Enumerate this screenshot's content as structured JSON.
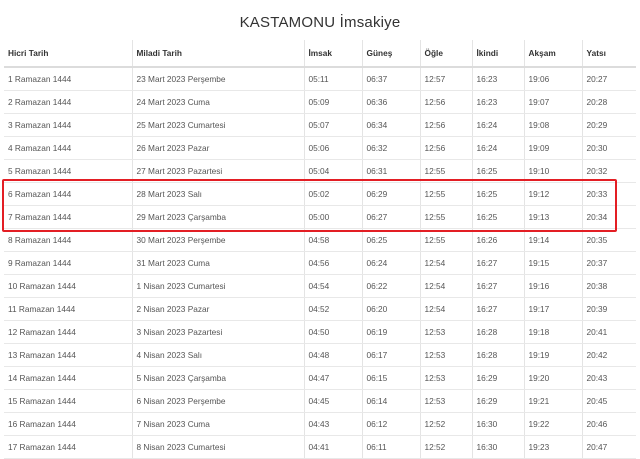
{
  "page": {
    "title": "KASTAMONU İmsakiye"
  },
  "table": {
    "columns": [
      "Hicri Tarih",
      "Miladi Tarih",
      "İmsak",
      "Güneş",
      "Öğle",
      "İkindi",
      "Akşam",
      "Yatsı"
    ],
    "rows": [
      [
        "1 Ramazan 1444",
        "23 Mart 2023 Perşembe",
        "05:11",
        "06:37",
        "12:57",
        "16:23",
        "19:06",
        "20:27"
      ],
      [
        "2 Ramazan 1444",
        "24 Mart 2023 Cuma",
        "05:09",
        "06:36",
        "12:56",
        "16:23",
        "19:07",
        "20:28"
      ],
      [
        "3 Ramazan 1444",
        "25 Mart 2023 Cumartesi",
        "05:07",
        "06:34",
        "12:56",
        "16:24",
        "19:08",
        "20:29"
      ],
      [
        "4 Ramazan 1444",
        "26 Mart 2023 Pazar",
        "05:06",
        "06:32",
        "12:56",
        "16:24",
        "19:09",
        "20:30"
      ],
      [
        "5 Ramazan 1444",
        "27 Mart 2023 Pazartesi",
        "05:04",
        "06:31",
        "12:55",
        "16:25",
        "19:10",
        "20:32"
      ],
      [
        "6 Ramazan 1444",
        "28 Mart 2023 Salı",
        "05:02",
        "06:29",
        "12:55",
        "16:25",
        "19:12",
        "20:33"
      ],
      [
        "7 Ramazan 1444",
        "29 Mart 2023 Çarşamba",
        "05:00",
        "06:27",
        "12:55",
        "16:25",
        "19:13",
        "20:34"
      ],
      [
        "8 Ramazan 1444",
        "30 Mart 2023 Perşembe",
        "04:58",
        "06:25",
        "12:55",
        "16:26",
        "19:14",
        "20:35"
      ],
      [
        "9 Ramazan 1444",
        "31 Mart 2023 Cuma",
        "04:56",
        "06:24",
        "12:54",
        "16:27",
        "19:15",
        "20:37"
      ],
      [
        "10 Ramazan 1444",
        "1 Nisan 2023 Cumartesi",
        "04:54",
        "06:22",
        "12:54",
        "16:27",
        "19:16",
        "20:38"
      ],
      [
        "11 Ramazan 1444",
        "2 Nisan 2023 Pazar",
        "04:52",
        "06:20",
        "12:54",
        "16:27",
        "19:17",
        "20:39"
      ],
      [
        "12 Ramazan 1444",
        "3 Nisan 2023 Pazartesi",
        "04:50",
        "06:19",
        "12:53",
        "16:28",
        "19:18",
        "20:41"
      ],
      [
        "13 Ramazan 1444",
        "4 Nisan 2023 Salı",
        "04:48",
        "06:17",
        "12:53",
        "16:28",
        "19:19",
        "20:42"
      ],
      [
        "14 Ramazan 1444",
        "5 Nisan 2023 Çarşamba",
        "04:47",
        "06:15",
        "12:53",
        "16:29",
        "19:20",
        "20:43"
      ],
      [
        "15 Ramazan 1444",
        "6 Nisan 2023 Perşembe",
        "04:45",
        "06:14",
        "12:53",
        "16:29",
        "19:21",
        "20:45"
      ],
      [
        "16 Ramazan 1444",
        "7 Nisan 2023 Cuma",
        "04:43",
        "06:12",
        "12:52",
        "16:30",
        "19:22",
        "20:46"
      ],
      [
        "17 Ramazan 1444",
        "8 Nisan 2023 Cumartesi",
        "04:41",
        "06:11",
        "12:52",
        "16:30",
        "19:23",
        "20:47"
      ]
    ]
  },
  "highlight": {
    "rows": [
      5,
      6
    ],
    "color": "#e31e24"
  }
}
